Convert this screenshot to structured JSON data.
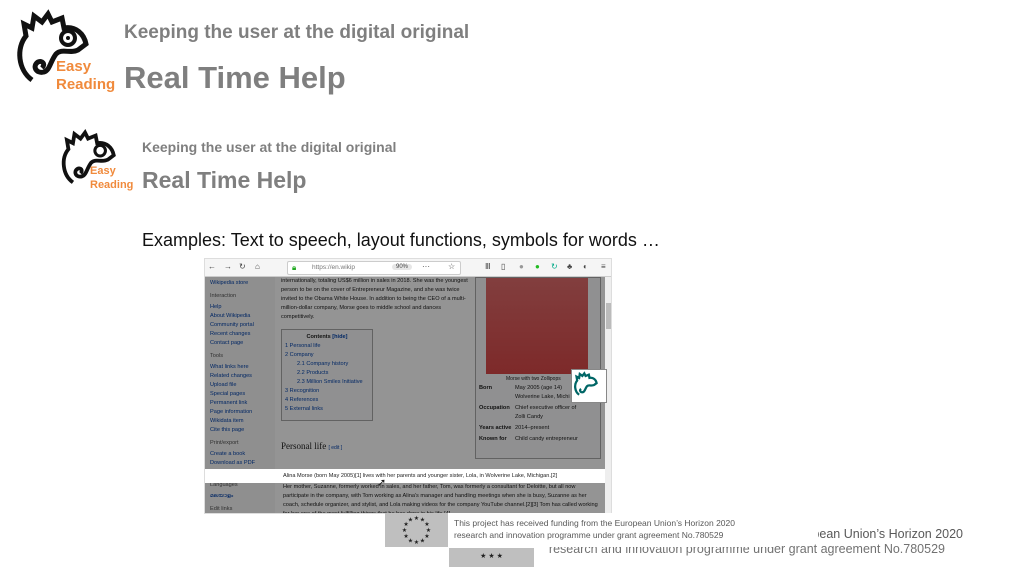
{
  "slide_outer": {
    "logo_line1": "Easy",
    "logo_line2": "Reading",
    "subtitle": "Keeping the user at the digital original",
    "title": "Real Time Help"
  },
  "slide_inner": {
    "logo_line1": "Easy",
    "logo_line2": "Reading",
    "subtitle": "Keeping the user at the digital original",
    "title": "Real Time Help"
  },
  "examples": "Examples: Text to speech, layout functions, symbols for words …",
  "browser": {
    "url": "https://en.wikip",
    "zoom": "90%",
    "sidebar": [
      {
        "t": "Wikipedia store",
        "h": false
      },
      {
        "t": "Interaction",
        "h": true
      },
      {
        "t": "Help",
        "h": false
      },
      {
        "t": "About Wikipedia",
        "h": false
      },
      {
        "t": "Community portal",
        "h": false
      },
      {
        "t": "Recent changes",
        "h": false
      },
      {
        "t": "Contact page",
        "h": false
      },
      {
        "t": "Tools",
        "h": true
      },
      {
        "t": "What links here",
        "h": false
      },
      {
        "t": "Related changes",
        "h": false
      },
      {
        "t": "Upload file",
        "h": false
      },
      {
        "t": "Special pages",
        "h": false
      },
      {
        "t": "Permanent link",
        "h": false
      },
      {
        "t": "Page information",
        "h": false
      },
      {
        "t": "Wikidata item",
        "h": false
      },
      {
        "t": "Cite this page",
        "h": false
      },
      {
        "t": "Print/export",
        "h": true
      },
      {
        "t": "Create a book",
        "h": false
      },
      {
        "t": "Download as PDF",
        "h": false
      },
      {
        "t": "Printable version",
        "h": false
      },
      {
        "t": "Languages",
        "h": true
      },
      {
        "t": "മലയാളം",
        "h": false
      },
      {
        "t": "Edit links",
        "h": true
      }
    ],
    "intro": "internationally, totaling US$6 million in sales in 2018. She was the youngest person to be on the cover of Entrepreneur Magazine, and she was twice invited to the Obama White House. In addition to being the CEO of a multi-million-dollar company, Morse goes to middle school and dances competitively.",
    "toc_title": "Contents",
    "toc_hide": "[hide]",
    "toc": [
      "1  Personal life",
      "2  Company",
      "2.1  Company history",
      "2.2  Products",
      "2.3  Million Smiles Initiative",
      "3  Recognition",
      "4  References",
      "5  External links"
    ],
    "section": "Personal life",
    "edit": "[ edit ]",
    "highlighted": "Alina Morse (born May 2005)[1] lives with her parents and younger sister, Lola, in Wolverine Lake, Michigan.[2]",
    "para": "Her mother, Suzanne, formerly worked in sales, and her father, Tom, was formerly a consultant for Deloitte, but all now participate in the company, with Tom working as Alina's manager and handling meetings when she is busy, Suzanne as her coach, schedule organizer, and stylist, and Lola making videos for the company YouTube channel.[2][3] Tom has called working for her one of the most fulfilling things that he has done in his life.[4]",
    "caption": "Morse with two Zollipops",
    "infobox": [
      {
        "k": "Born",
        "v": "May 2005 (age 14) Wolverine Lake, Michi"
      },
      {
        "k": "Occupation",
        "v": "Chief executive officer of Zolli Candy"
      },
      {
        "k": "Years active",
        "v": "2014–present"
      },
      {
        "k": "Known for",
        "v": "Child candy entrepreneur"
      }
    ]
  },
  "funding": {
    "line1": "This project has received funding from the European Union’s Horizon 2020",
    "line2": "research and innovation programme under grant agreement No.780529"
  }
}
